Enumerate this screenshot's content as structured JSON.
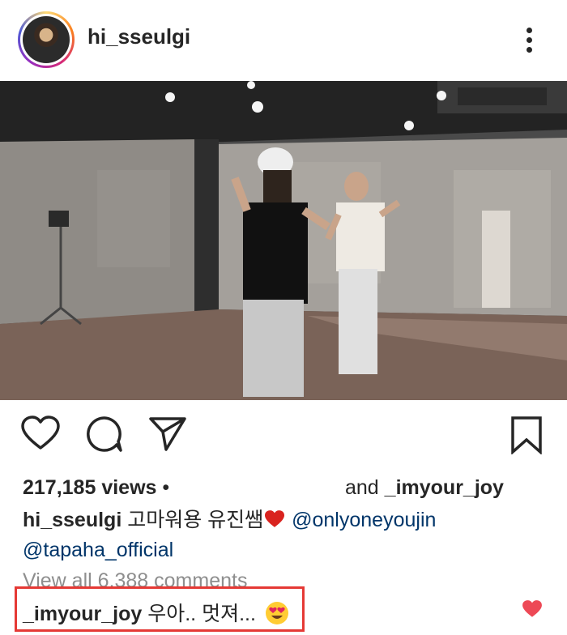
{
  "post": {
    "username": "hi_sseulgi"
  },
  "actions": {
    "like_icon": "heart-outline-icon",
    "comment_icon": "comment-bubble-icon",
    "share_icon": "paper-plane-icon",
    "save_icon": "bookmark-icon"
  },
  "stats": {
    "views": "217,185 views",
    "separator": "•",
    "and_prefix": "and",
    "and_user": "_imyour_joy"
  },
  "caption": {
    "username": "hi_sseulgi",
    "text": "고마워용 유진쌤",
    "mention1": "@onlyoneyoujin",
    "mention2": "@tapaha_official"
  },
  "comments": {
    "view_all": "View all 6,388 comments",
    "featured": {
      "username": "_imyour_joy",
      "text": "우아.. 멋져..."
    }
  },
  "colors": {
    "highlight": "#e53935",
    "heart_red": "#ed4956",
    "mention": "#003569",
    "muted": "#8e8e8e"
  }
}
